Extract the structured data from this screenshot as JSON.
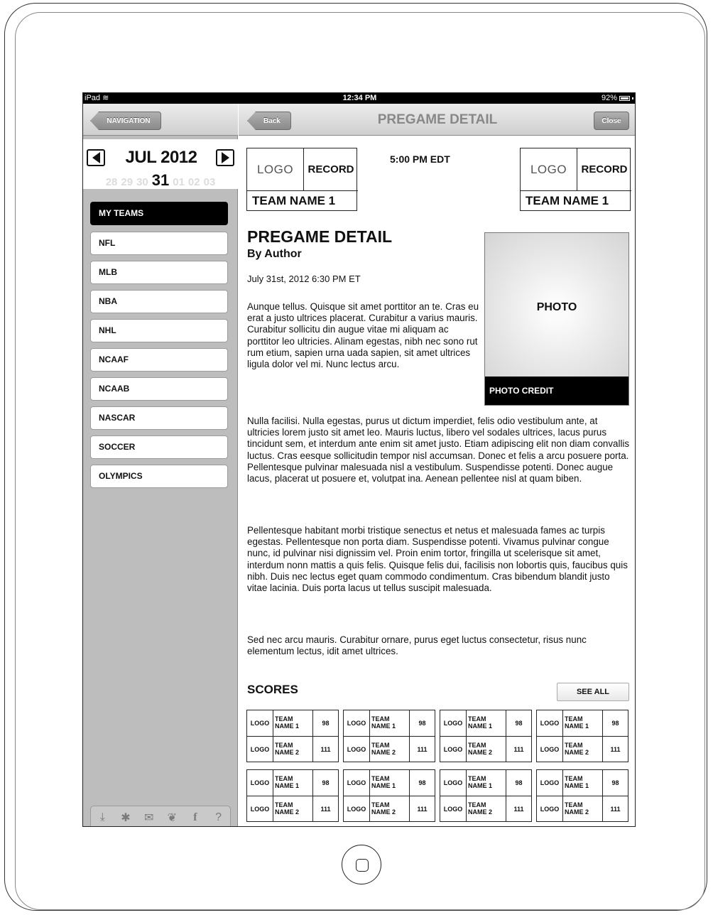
{
  "status_bar": {
    "carrier": "iPad",
    "time": "12:34 PM",
    "battery": "92%"
  },
  "sidebar": {
    "nav_button": "NAVIGATION",
    "calendar": {
      "month": "JUL 2012",
      "days": [
        "28",
        "29",
        "30",
        "31",
        "01",
        "02",
        "03"
      ],
      "selected_day": "31"
    },
    "items": [
      {
        "label": "MY TEAMS",
        "active": true
      },
      {
        "label": "NFL"
      },
      {
        "label": "MLB"
      },
      {
        "label": "NBA"
      },
      {
        "label": "NHL"
      },
      {
        "label": "NCAAF"
      },
      {
        "label": "NCAAB"
      },
      {
        "label": "NASCAR"
      },
      {
        "label": "SOCCER"
      },
      {
        "label": "OLYMPICS"
      }
    ],
    "toolbar_icons": [
      "download-icon",
      "gear-icon",
      "mail-icon",
      "twitter-icon",
      "facebook-icon",
      "help-icon"
    ]
  },
  "header": {
    "back_label": "Back",
    "title": "PREGAME DETAIL",
    "close_label": "Close"
  },
  "matchup": {
    "team1": {
      "logo": "LOGO",
      "record": "RECORD",
      "name": "TEAM NAME 1"
    },
    "team2": {
      "logo": "LOGO",
      "record": "RECORD",
      "name": "TEAM NAME 1"
    },
    "time": "5:00 PM EDT"
  },
  "article": {
    "title": "PREGAME DETAIL",
    "author": "By Author",
    "date": "July 31st, 2012 6:30 PM ET",
    "photo_label": "PHOTO",
    "photo_credit": "PHOTO CREDIT",
    "paragraphs": [
      "Aunque tellus. Quisque sit amet porttitor an te. Cras eu erat a justo ultrices placerat. Curabitur a varius mauris. Curabitur sollicitu din augue vitae mi aliquam ac porttitor leo ultricies. Alinam egestas, nibh nec sono rut rum etium, sapien urna uada sapien, sit amet ultrices ligula dolor vel mi. Nunc lectus arcu.",
      "Nulla facilisi. Nulla egestas, purus ut dictum imperdiet, felis odio vestibulum ante, at ultricies lorem justo sit amet leo. Mauris luctus, libero vel sodales ultrices, lacus purus tincidunt sem, et interdum ante enim sit amet justo. Etiam adipiscing elit non diam convallis luctus. Cras eesque sollicitudin tempor nisl accumsan. Donec et felis a arcu posuere porta. Pellentesque pulvinar malesuada nisl a vestibulum. Suspendisse potenti. Donec augue lacus, placerat ut posuere et, volutpat ina. Aenean pellentee nisl at quam biben.",
      "Pellentesque habitant morbi tristique senectus et netus et malesuada fames ac turpis egestas. Pellentesque non porta diam. Suspendisse potenti. Vivamus pulvinar congue nunc, id pulvinar nisi dignissim vel. Proin enim tortor, fringilla ut scelerisque sit amet, interdum nonn mattis a quis felis. Quisque felis dui, facilisis non lobortis quis, faucibus quis nibh. Duis nec lectus eget quam commodo condimentum. Cras bibendum blandit justo vitae lacinia. Duis porta lacus ut tellus suscipit malesuada.",
      "Sed nec arcu mauris. Curabitur ornare, purus eget luctus consectetur, risus nunc elementum lectus, idit amet ultrices."
    ]
  },
  "scores": {
    "title": "SCORES",
    "see_all": "SEE ALL",
    "cards": [
      {
        "logo1": "LOGO",
        "team1": "TEAM NAME 1",
        "score1": "98",
        "logo2": "LOGO",
        "team2": "TEAM NAME 2",
        "score2": "111"
      },
      {
        "logo1": "LOGO",
        "team1": "TEAM NAME 1",
        "score1": "98",
        "logo2": "LOGO",
        "team2": "TEAM NAME 2",
        "score2": "111"
      },
      {
        "logo1": "LOGO",
        "team1": "TEAM NAME 1",
        "score1": "98",
        "logo2": "LOGO",
        "team2": "TEAM NAME 2",
        "score2": "111"
      },
      {
        "logo1": "LOGO",
        "team1": "TEAM NAME 1",
        "score1": "98",
        "logo2": "LOGO",
        "team2": "TEAM NAME 2",
        "score2": "111"
      },
      {
        "logo1": "LOGO",
        "team1": "TEAM NAME 1",
        "score1": "98",
        "logo2": "LOGO",
        "team2": "TEAM NAME 2",
        "score2": "111"
      },
      {
        "logo1": "LOGO",
        "team1": "TEAM NAME 1",
        "score1": "98",
        "logo2": "LOGO",
        "team2": "TEAM NAME 2",
        "score2": "111"
      },
      {
        "logo1": "LOGO",
        "team1": "TEAM NAME 1",
        "score1": "98",
        "logo2": "LOGO",
        "team2": "TEAM NAME 2",
        "score2": "111"
      },
      {
        "logo1": "LOGO",
        "team1": "TEAM NAME 1",
        "score1": "98",
        "logo2": "LOGO",
        "team2": "TEAM NAME 2",
        "score2": "111"
      }
    ]
  }
}
